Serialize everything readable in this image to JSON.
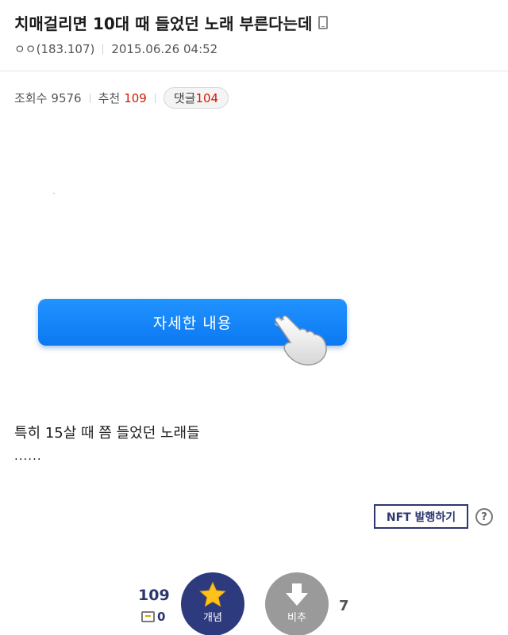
{
  "post": {
    "title": "치매걸리면 10대 때 들었던 노래 부른다는데",
    "author": "ㅇㅇ(183.107)",
    "date": "2015.06.26 04:52"
  },
  "stats": {
    "views_label": "조회수",
    "views": "9576",
    "recommend_label": "추천",
    "recommend": "109",
    "comments_label": "댓글",
    "comments": "104"
  },
  "content": {
    "detail_button": "자세한 내용",
    "text": "특히 15살 때 쯤 들었던 노래들",
    "ellipsis": "......"
  },
  "actions": {
    "nft_label": "NFT 발행하기",
    "help": "?"
  },
  "vote": {
    "up_count": "109",
    "fix_count": "0",
    "up_label": "개념",
    "down_label": "비추",
    "down_count": "7"
  },
  "colors": {
    "accent_blue": "#0c78f2",
    "navy": "#2d3a7d",
    "red": "#d31900",
    "gray": "#9a9a9a"
  },
  "icons": [
    "mobile-icon",
    "hand-pointer-icon",
    "star-icon",
    "down-arrow-icon",
    "fix-icon",
    "help-icon"
  ]
}
